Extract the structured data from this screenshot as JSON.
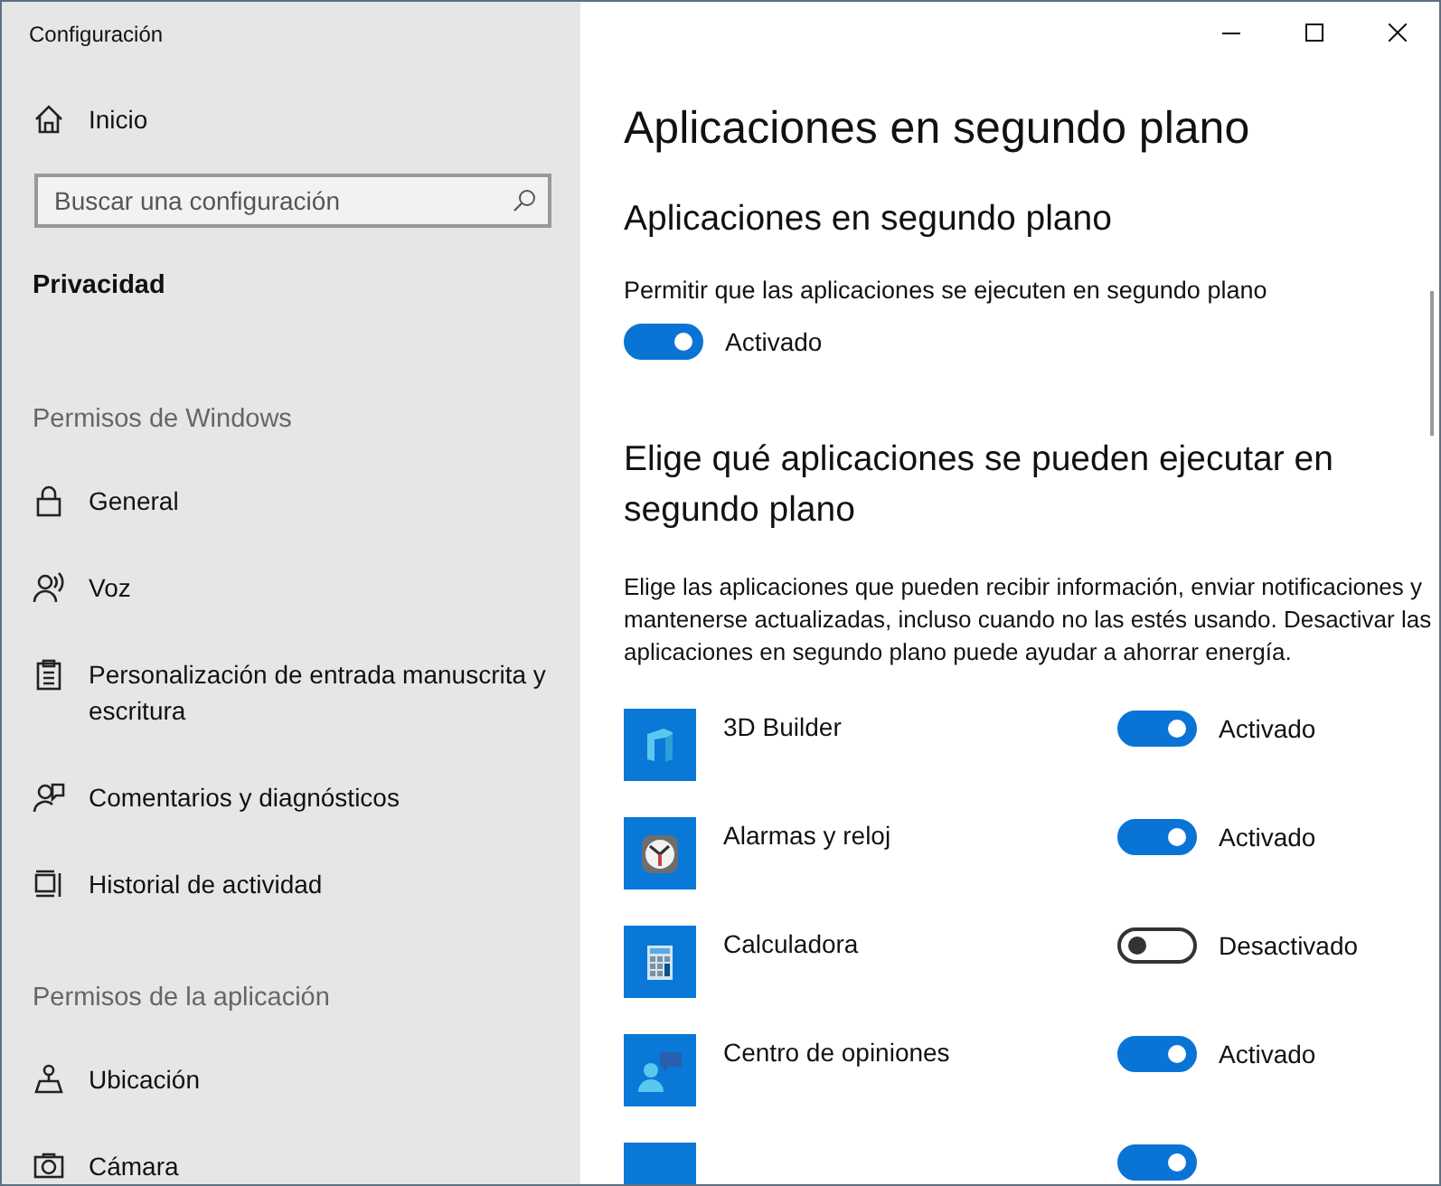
{
  "window": {
    "title": "Configuración",
    "controls": [
      {
        "kind": "minimize"
      },
      {
        "kind": "maximize"
      },
      {
        "kind": "close"
      }
    ]
  },
  "sidebar": {
    "home": {
      "label": "Inicio",
      "kind": "home"
    },
    "search": {
      "placeholder": "Buscar una configuración"
    },
    "section_title": "Privacidad",
    "groups": [
      {
        "heading": "Permisos de Windows",
        "items": [
          {
            "label": "General",
            "kind": "lock",
            "selected": false
          },
          {
            "label": "Voz",
            "kind": "voice",
            "selected": false
          },
          {
            "label": "Personalización de entrada manuscrita y escritura",
            "kind": "clipboard",
            "selected": false
          },
          {
            "label": "Comentarios y diagnósticos",
            "kind": "feedback",
            "selected": false
          },
          {
            "label": "Historial de actividad",
            "kind": "timeline",
            "selected": false
          }
        ]
      },
      {
        "heading": "Permisos de la aplicación",
        "items": [
          {
            "label": "Ubicación",
            "kind": "location",
            "selected": false
          },
          {
            "label": "Cámara",
            "kind": "camera",
            "selected": false
          }
        ]
      }
    ]
  },
  "content": {
    "title": "Aplicaciones en segundo plano",
    "master": {
      "heading": "Aplicaciones en segundo plano",
      "label": "Permitir que las aplicaciones se ejecuten en segundo plano",
      "on": true,
      "state_text": "Activado"
    },
    "apps_heading": "Elige qué aplicaciones se pueden ejecutar en segundo plano",
    "description": "Elige las aplicaciones que pueden recibir información, enviar notificaciones y mantenerse actualizadas, incluso cuando no las estés usando. Desactivar las aplicaciones en segundo plano puede ayudar a ahorrar energía.",
    "apps": [
      {
        "name": "3D Builder",
        "kind": "builder",
        "on": true,
        "state_text": "Activado"
      },
      {
        "name": "Alarmas y reloj",
        "kind": "clock",
        "on": true,
        "state_text": "Activado"
      },
      {
        "name": "Calculadora",
        "kind": "calculator",
        "on": false,
        "state_text": "Desactivado"
      },
      {
        "name": "Centro de opiniones",
        "kind": "feedback",
        "on": true,
        "state_text": "Activado"
      },
      {
        "kind": "generic",
        "on": true
      }
    ]
  }
}
